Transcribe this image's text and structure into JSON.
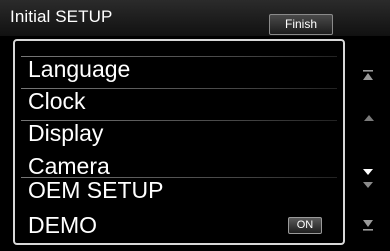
{
  "header": {
    "title": "Initial SETUP",
    "finish_label": "Finish"
  },
  "menu": {
    "items": [
      {
        "label": "Language"
      },
      {
        "label": "Clock"
      },
      {
        "label": "Display"
      },
      {
        "label": "Camera"
      },
      {
        "label": "OEM SETUP"
      },
      {
        "label": "DEMO",
        "toggle_label": "ON"
      }
    ]
  },
  "scrollbar": {
    "icons": [
      "scroll-top-icon",
      "scroll-up-icon",
      "scroll-down-icon",
      "scroll-bottom-icon"
    ]
  }
}
